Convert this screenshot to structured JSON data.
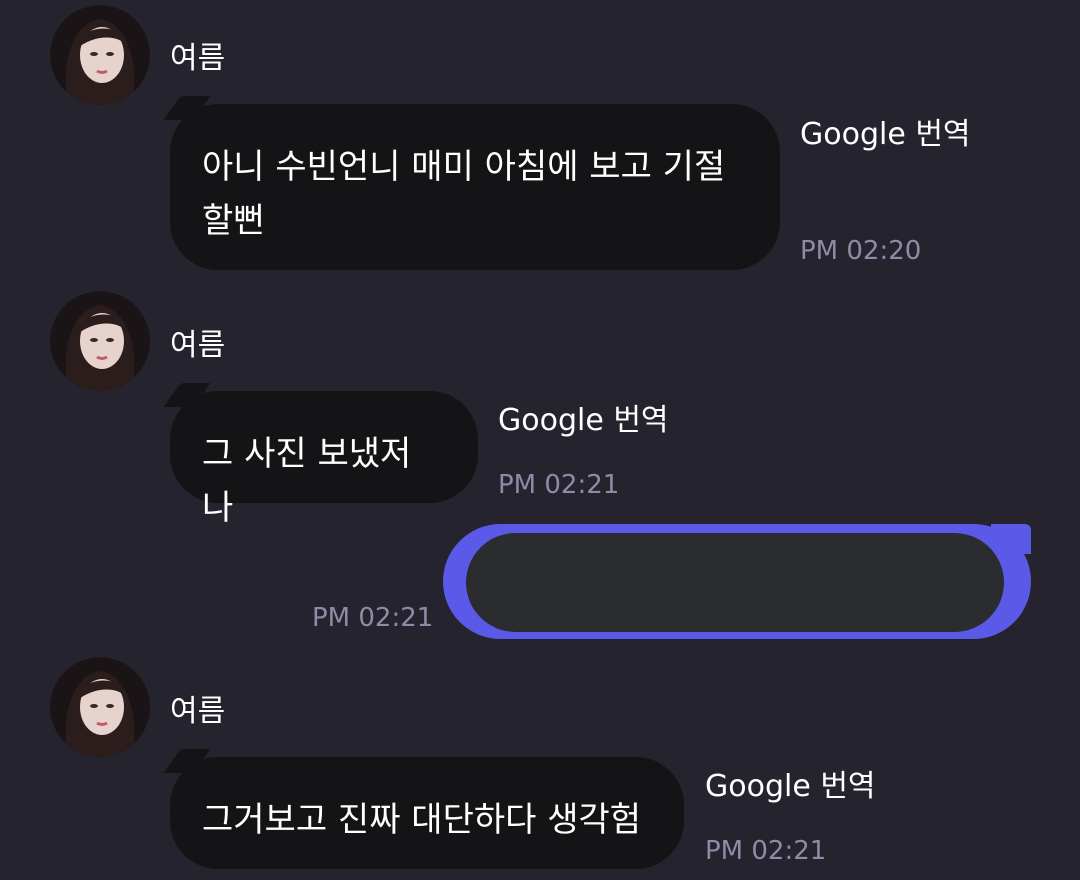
{
  "messages": [
    {
      "sender": "여름",
      "text": "아니 수빈언니 매미 아침에 보고 기절\n할뻔",
      "translate_label": "Google 번역",
      "time": "PM 02:20"
    },
    {
      "sender": "여름",
      "text": "그 사진 보냈저나",
      "translate_label": "Google 번역",
      "time": "PM 02:21"
    },
    {
      "mine": true,
      "text": "",
      "time": "PM 02:21"
    },
    {
      "sender": "여름",
      "text": "그거보고 진짜 대단하다 생각험",
      "translate_label": "Google 번역",
      "time": "PM 02:21"
    }
  ],
  "colors": {
    "background": "#25242e",
    "incoming_bubble": "#141416",
    "outgoing_bubble": "#5b5ae8",
    "redacted": "#2a2c30",
    "timestamp": "#8e8ba6"
  }
}
